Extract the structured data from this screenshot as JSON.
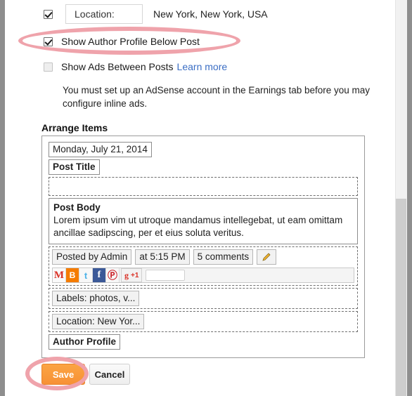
{
  "options": {
    "location": {
      "checked": true,
      "field_label": "Location:",
      "value": "New York, New York, USA"
    },
    "author_profile": {
      "checked": true,
      "label": "Show Author Profile Below Post"
    },
    "ads": {
      "checked": false,
      "label": "Show Ads Between Posts",
      "link_label": "Learn more",
      "note": "You must set up an AdSense account in the Earnings tab before you may configure inline ads."
    }
  },
  "arrange": {
    "title": "Arrange Items",
    "date_chip": "Monday, July 21, 2014",
    "post_title_chip": "Post Title",
    "empty_zone_label": "",
    "post_body": {
      "heading": "Post Body",
      "text": "Lorem ipsum vim ut utroque mandamus intellegebat, ut eam omittam ancillae sadipscing, per et eius soluta veritus."
    },
    "meta": {
      "author": "Posted by Admin",
      "time": "at 5:15 PM",
      "comments": "5 comments",
      "edit_icon": "pencil-icon"
    },
    "share": {
      "icons": [
        "gmail-icon",
        "blogger-icon",
        "twitter-icon",
        "facebook-icon",
        "pinterest-icon"
      ],
      "gmail_glyph": "M",
      "blogger_glyph": "B",
      "twitter_glyph": "t",
      "facebook_glyph": "f",
      "pinterest_glyph": "Ⓟ",
      "gplus_glyph": "g",
      "gplus_label": "+1",
      "gplus_count": ""
    },
    "labels_chip": "Labels: photos, v...",
    "location_chip": "Location: New Yor...",
    "author_profile_chip": "Author Profile"
  },
  "buttons": {
    "save": "Save",
    "cancel": "Cancel"
  },
  "colors": {
    "accent_orange": "#f79135",
    "highlight_pink": "#efa3ab",
    "link_blue": "#3b6ec4",
    "scroll_thumb": "#cdcdcd"
  }
}
